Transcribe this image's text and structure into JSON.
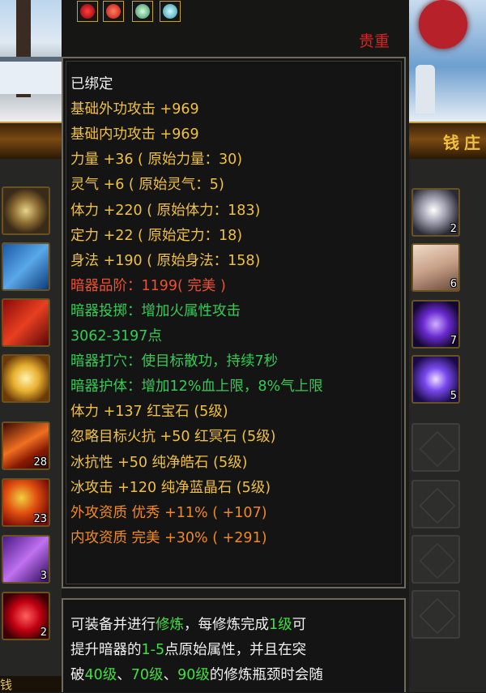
{
  "colors": {
    "white": "#f0f0f0",
    "gold": "#f0c040",
    "red": "#f05030",
    "green": "#33cc55",
    "orange": "#f08a20",
    "rarity_red": "#e02020"
  },
  "header": {
    "gem_icons": [
      "red-rune-icon",
      "red-orb-icon",
      "green-rune-icon",
      "teal-orb-icon"
    ],
    "rarity": "贵重"
  },
  "shop": {
    "title": "钱庄",
    "bottom_label": "钱"
  },
  "tooltip": {
    "lines": [
      {
        "text": "已绑定",
        "color": "white"
      },
      {
        "text": "基础外功攻击 +969",
        "color": "gold"
      },
      {
        "text": "基础内功攻击 +969",
        "color": "gold"
      },
      {
        "text": "力量 +36 ( 原始力量：30)",
        "color": "gold"
      },
      {
        "text": "灵气 +6 ( 原始灵气：5)",
        "color": "gold"
      },
      {
        "text": "体力 +220 ( 原始体力：183)",
        "color": "gold"
      },
      {
        "text": "定力 +22 ( 原始定力：18)",
        "color": "gold"
      },
      {
        "text": "身法 +190 ( 原始身法：158)",
        "color": "gold"
      },
      {
        "text": "暗器品阶：1199( 完美 )",
        "color": "red"
      },
      {
        "text": "暗器投掷：增加火属性攻击",
        "color": "green"
      },
      {
        "text": "3062-3197点",
        "color": "green"
      },
      {
        "text": "暗器打穴：使目标散功，持续7秒",
        "color": "green"
      },
      {
        "text": "暗器护体：增加12%血上限，8%气上限",
        "color": "green"
      },
      {
        "text": "体力 +137 红宝石 (5级)",
        "color": "gold"
      },
      {
        "text": "忽略目标火抗 +50 红冥石 (5级)",
        "color": "gold"
      },
      {
        "text": "冰抗性 +50 纯净皓石 (5级)",
        "color": "gold"
      },
      {
        "text": "冰攻击 +120 纯净蓝晶石 (5级)",
        "color": "gold"
      },
      {
        "text": "外攻资质  优秀 +11% ( +107)",
        "color": "orange"
      },
      {
        "text": "内攻资质  完美 +30% ( +291)",
        "color": "orange"
      }
    ],
    "description": {
      "line1": {
        "a": "可装备并进行",
        "b": "修炼",
        "c": "，每修炼完成",
        "d": "1级",
        "e": "可"
      },
      "line2": {
        "a": "提升暗器的",
        "b": "1-5",
        "c": "点原始属性，并且在突"
      },
      "line3": {
        "a": "破",
        "b": "40级",
        "c": "、",
        "d": "70级",
        "e": "、",
        "f": "90级",
        "g": "的修炼瓶颈时会随"
      }
    }
  },
  "inventory_left": [
    {
      "icon": "ring-icon",
      "count": ""
    },
    {
      "icon": "silver-needle-icon",
      "count": ""
    },
    {
      "icon": "red-feather-icon",
      "count": ""
    },
    {
      "icon": "golden-lotus-icon",
      "count": ""
    },
    {
      "icon": "fire-scroll-icon",
      "count": "28"
    },
    {
      "icon": "fire-dragon-icon",
      "count": "23"
    },
    {
      "icon": "purple-scroll-icon",
      "count": "3"
    },
    {
      "icon": "red-orb-icon",
      "count": "2"
    }
  ],
  "inventory_right": [
    {
      "icon": "diamond-icon",
      "count": "2"
    },
    {
      "icon": "cloth-icon",
      "count": "6"
    },
    {
      "icon": "purple-crystal-icon",
      "count": "7"
    },
    {
      "icon": "magic-orb-icon",
      "count": "5"
    },
    {
      "icon": "empty-slot",
      "count": ""
    },
    {
      "icon": "empty-slot",
      "count": ""
    },
    {
      "icon": "empty-slot",
      "count": ""
    },
    {
      "icon": "empty-slot",
      "count": ""
    }
  ]
}
